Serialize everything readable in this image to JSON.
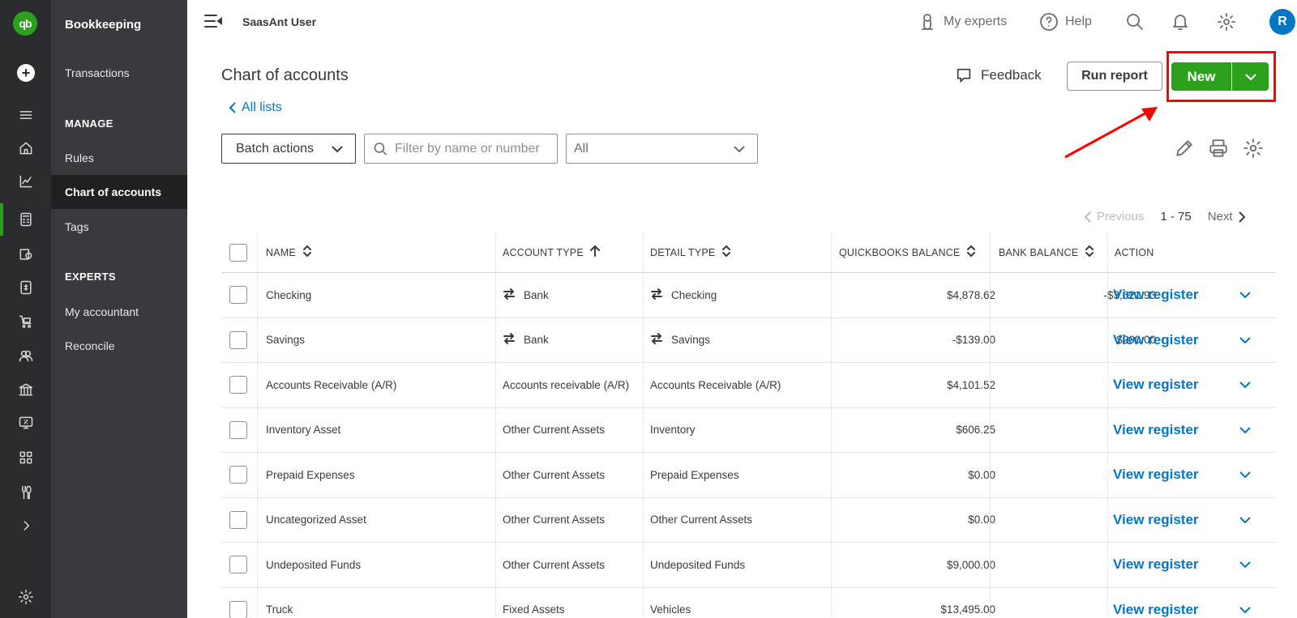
{
  "sidebar": {
    "logo_text": "qb",
    "title": "Bookkeeping",
    "items": [
      {
        "label": "Transactions"
      },
      {
        "label": "Rules"
      },
      {
        "label": "Chart of accounts"
      },
      {
        "label": "Tags"
      },
      {
        "label": "My accountant"
      },
      {
        "label": "Reconcile"
      }
    ],
    "sections": {
      "manage": "MANAGE",
      "experts": "EXPERTS"
    },
    "rail_icons": [
      "menu-icon",
      "home-icon",
      "chart-icon",
      "calculator-icon",
      "receipt-icon",
      "invoice-icon",
      "cart-icon",
      "people-icon",
      "bank-icon",
      "tax-icon",
      "apps-icon",
      "tools-icon",
      "chevron-right-icon",
      "gear-icon"
    ]
  },
  "topbar": {
    "company": "SaasAnt User",
    "my_experts": "My experts",
    "help": "Help",
    "avatar_initial": "R"
  },
  "page": {
    "title": "Chart of accounts",
    "back_link": "All lists",
    "feedback": "Feedback",
    "run_report": "Run report",
    "new_label": "New"
  },
  "toolbar": {
    "batch_actions": "Batch actions",
    "search_placeholder": "Filter by name or number",
    "filter_value": "All"
  },
  "pager": {
    "previous": "Previous",
    "range": "1 - 75",
    "next": "Next"
  },
  "table": {
    "headers": {
      "name": "NAME",
      "account_type": "ACCOUNT TYPE",
      "detail_type": "DETAIL TYPE",
      "qb_balance": "QUICKBOOKS BALANCE",
      "bank_balance": "BANK BALANCE",
      "action": "ACTION"
    },
    "action_label": "View register",
    "rows": [
      {
        "name": "Checking",
        "account_type": "Bank",
        "detail_type": "Checking",
        "qb_balance": "$4,878.62",
        "bank_balance": "-$3,621.93"
      },
      {
        "name": "Savings",
        "account_type": "Bank",
        "detail_type": "Savings",
        "qb_balance": "-$139.00",
        "bank_balance": "$200.00"
      },
      {
        "name": "Accounts Receivable (A/R)",
        "account_type": "Accounts receivable (A/R)",
        "detail_type": "Accounts Receivable (A/R)",
        "qb_balance": "$4,101.52",
        "bank_balance": ""
      },
      {
        "name": "Inventory Asset",
        "account_type": "Other Current Assets",
        "detail_type": "Inventory",
        "qb_balance": "$606.25",
        "bank_balance": ""
      },
      {
        "name": "Prepaid Expenses",
        "account_type": "Other Current Assets",
        "detail_type": "Prepaid Expenses",
        "qb_balance": "$0.00",
        "bank_balance": ""
      },
      {
        "name": "Uncategorized Asset",
        "account_type": "Other Current Assets",
        "detail_type": "Other Current Assets",
        "qb_balance": "$0.00",
        "bank_balance": ""
      },
      {
        "name": "Undeposited Funds",
        "account_type": "Other Current Assets",
        "detail_type": "Undeposited Funds",
        "qb_balance": "$9,000.00",
        "bank_balance": ""
      },
      {
        "name": "Truck",
        "account_type": "Fixed Assets",
        "detail_type": "Vehicles",
        "qb_balance": "$13,495.00",
        "bank_balance": ""
      }
    ]
  },
  "colors": {
    "brand_green": "#2ca01c",
    "link_blue": "#0077c5",
    "annotation_red": "#ff0000",
    "rail_bg": "#2b2c2e",
    "nav_bg": "#393a3d"
  }
}
